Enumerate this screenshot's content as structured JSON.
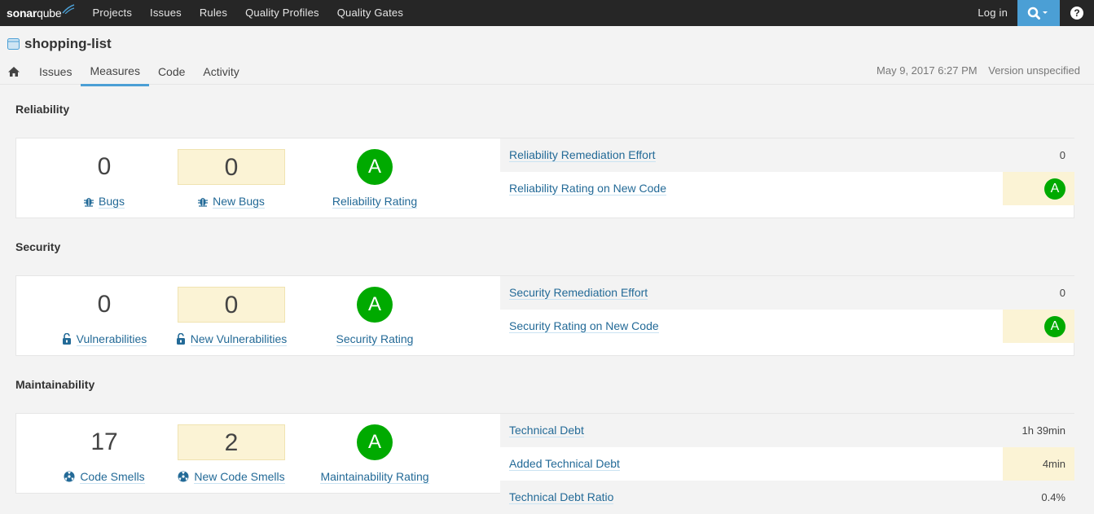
{
  "topbar": {
    "logo_text_bold": "sonar",
    "logo_text_light": "qube",
    "nav": [
      "Projects",
      "Issues",
      "Rules",
      "Quality Profiles",
      "Quality Gates"
    ],
    "login": "Log in",
    "search_icon": "search-icon",
    "help_label": "?"
  },
  "project": {
    "name": "shopping-list",
    "date": "May 9, 2017 6:27 PM",
    "version": "Version unspecified",
    "tabs": [
      "Issues",
      "Measures",
      "Code",
      "Activity"
    ],
    "active_tab": "Measures"
  },
  "colors": {
    "accent": "#4b9fd5",
    "rating_a": "#00aa00",
    "new_period": "#fbf3d5",
    "link": "#236a97"
  },
  "sections": [
    {
      "title": "Reliability",
      "measures": [
        {
          "value": "0",
          "label": "Bugs",
          "icon": "bug-icon"
        },
        {
          "value": "0",
          "label": "New Bugs",
          "icon": "bug-icon"
        },
        {
          "rating": "A",
          "label": "Reliability Rating"
        }
      ],
      "side": [
        {
          "label": "Reliability Remediation Effort",
          "value": "0"
        },
        {
          "label": "Reliability Rating on New Code",
          "rating": "A"
        }
      ]
    },
    {
      "title": "Security",
      "measures": [
        {
          "value": "0",
          "label": "Vulnerabilities",
          "icon": "lock-icon"
        },
        {
          "value": "0",
          "label": "New Vulnerabilities",
          "icon": "lock-icon"
        },
        {
          "rating": "A",
          "label": "Security Rating"
        }
      ],
      "side": [
        {
          "label": "Security Remediation Effort",
          "value": "0"
        },
        {
          "label": "Security Rating on New Code",
          "rating": "A"
        }
      ]
    },
    {
      "title": "Maintainability",
      "measures": [
        {
          "value": "17",
          "label": "Code Smells",
          "icon": "code-smell-icon"
        },
        {
          "value": "2",
          "label": "New Code Smells",
          "icon": "code-smell-icon"
        },
        {
          "rating": "A",
          "label": "Maintainability Rating"
        }
      ],
      "side": [
        {
          "label": "Technical Debt",
          "value": "1h 39min"
        },
        {
          "label": "Added Technical Debt",
          "value": "4min"
        },
        {
          "label": "Technical Debt Ratio",
          "value": "0.4%"
        }
      ]
    }
  ]
}
